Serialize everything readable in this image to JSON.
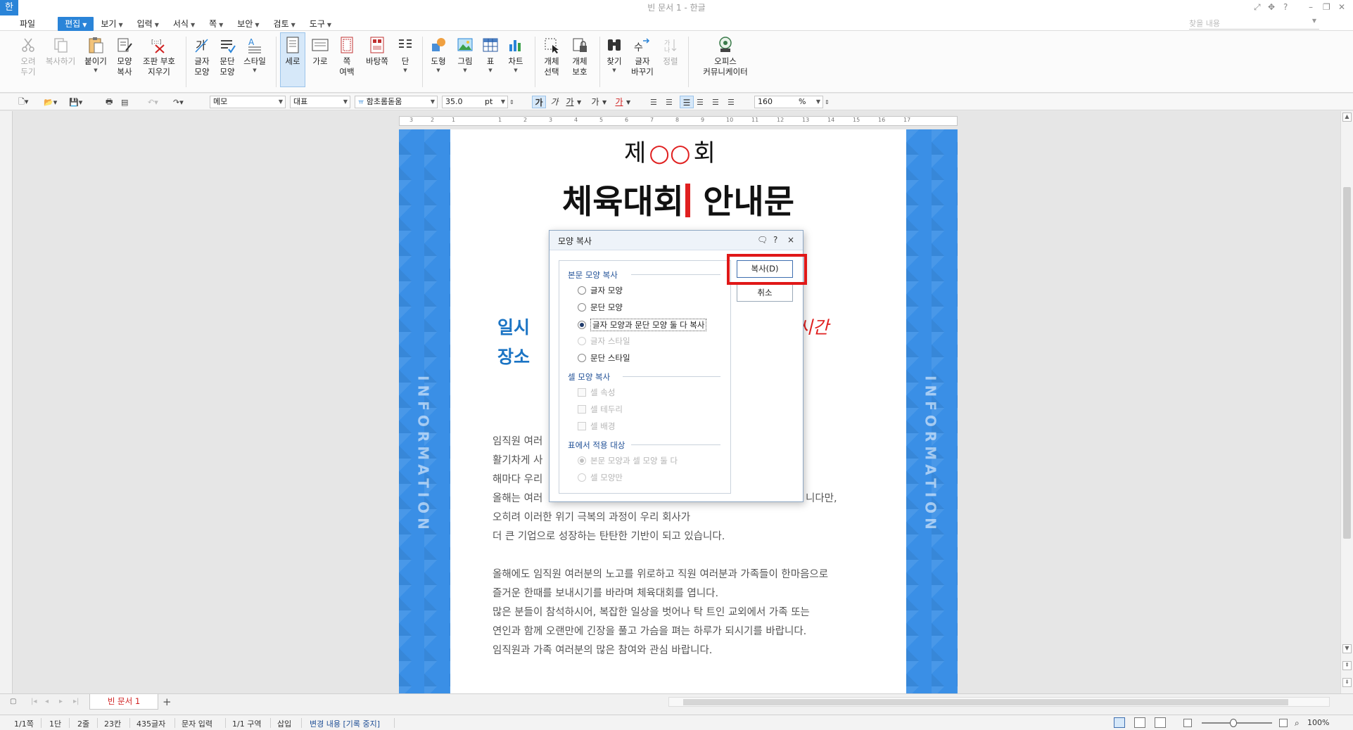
{
  "app": {
    "logo": "한",
    "title": "빈 문서 1 - 한글"
  },
  "menu": {
    "file": "파일",
    "items": [
      {
        "label": "편집",
        "active": true
      },
      {
        "label": "보기"
      },
      {
        "label": "입력"
      },
      {
        "label": "서식"
      },
      {
        "label": "쪽"
      },
      {
        "label": "보안"
      },
      {
        "label": "검토"
      },
      {
        "label": "도구"
      }
    ],
    "help_search": "찾을 내용"
  },
  "ribbon": {
    "cut": "오려\n두기",
    "copy": "복사하기",
    "paste": "붙이기",
    "format_copy": "모양\n복사",
    "clear_marks": "조판 부호\n지우기",
    "char_shape": "글자\n모양",
    "para_shape": "문단\n모양",
    "style": "스타일",
    "portrait": "세로",
    "landscape": "가로",
    "margins": "쪽\n여백",
    "background": "바탕쪽",
    "columns": "단",
    "shape": "도형",
    "picture": "그림",
    "table": "표",
    "chart": "차트",
    "obj_select": "개체\n선택",
    "obj_protect": "개체\n보호",
    "find": "찾기",
    "replace": "글자\n바꾸기",
    "sort": "정렬",
    "office_community": "오피스\n커뮤니케이터"
  },
  "format_toolbar": {
    "style_name": "메모",
    "font_lang": "대표",
    "font_name": "함초롬돋움",
    "font_size": "35.0",
    "size_unit": "pt",
    "zoom_value": "160",
    "zoom_unit": "%"
  },
  "ruler_marks": [
    "3",
    "2",
    "1",
    "1",
    "2",
    "3",
    "4",
    "5",
    "6",
    "7",
    "8",
    "9",
    "10",
    "11",
    "12",
    "13",
    "14",
    "15",
    "16",
    "17"
  ],
  "document": {
    "number_prefix": "제",
    "number_mark": "○○",
    "number_suffix": "회",
    "heading_left": "체육대회",
    "heading_right": "안내문",
    "label_date": "일시",
    "label_place": "장소",
    "time_fragment": "시간",
    "band_text": "INFORMATION",
    "paragraphs": [
      "임직원 여러",
      "활기차게 사",
      "해마다 우리",
      "올해는 여러",
      "오히려 이러한 위기 극복의 과정이 우리 회사가",
      "더 큰 기업으로 성장하는 탄탄한 기반이 되고 있습니다.",
      "올해에도 임직원 여러분의 노고를 위로하고 직원 여러분과 가족들이 한마음으로",
      "즐거운 한때를 보내시기를 바라며 체육대회를 엽니다.",
      "많은 분들이 참석하시어, 복잡한 일상을 벗어나 탁 트인 교외에서 가족 또는",
      "연인과 함께 오랜만에 긴장을 풀고 가슴을 펴는 하루가 되시기를 바랍니다.",
      "임직원과 가족 여러분의 많은 참여와 관심 바랍니다."
    ],
    "para4_tail": "니다만,"
  },
  "dialog": {
    "title": "모양 복사",
    "help_btn": "?",
    "close_btn": "×",
    "group_body": "본문 모양 복사",
    "opt_char": "글자 모양",
    "opt_para": "문단 모양",
    "opt_both": "글자 모양과 문단 모양 둘 다 복사",
    "opt_char_style": "글자 스타일",
    "opt_para_style": "문단 스타일",
    "group_cell": "셀 모양 복사",
    "opt_cell_attr": "셀 속성",
    "opt_cell_border": "셀 테두리",
    "opt_cell_bg": "셀 배경",
    "group_table": "표에서 적용 대상",
    "opt_table_both": "본문 모양과 셀 모양 둘 다",
    "opt_table_cell": "셀 모양만",
    "copy_button": "복사(D)",
    "cancel_button": "취소",
    "selected_option": "글자 모양과 문단 모양 둘 다 복사"
  },
  "tabs": {
    "doc_tab": "빈 문서 1",
    "add": "+"
  },
  "status": {
    "page": "1/1쪽",
    "column": "1단",
    "line": "2줄",
    "col_pos": "23칸",
    "chars": "435글자",
    "mode": "문자 입력",
    "section": "1/1 구역",
    "insert": "삽입",
    "track": "변경 내용 [기록 중지]",
    "zoom": "100%"
  },
  "colors": {
    "accent": "#2a84d8",
    "band": "#3a8fe6",
    "highlight": "#e01818",
    "label_blue": "#1b74c4"
  }
}
